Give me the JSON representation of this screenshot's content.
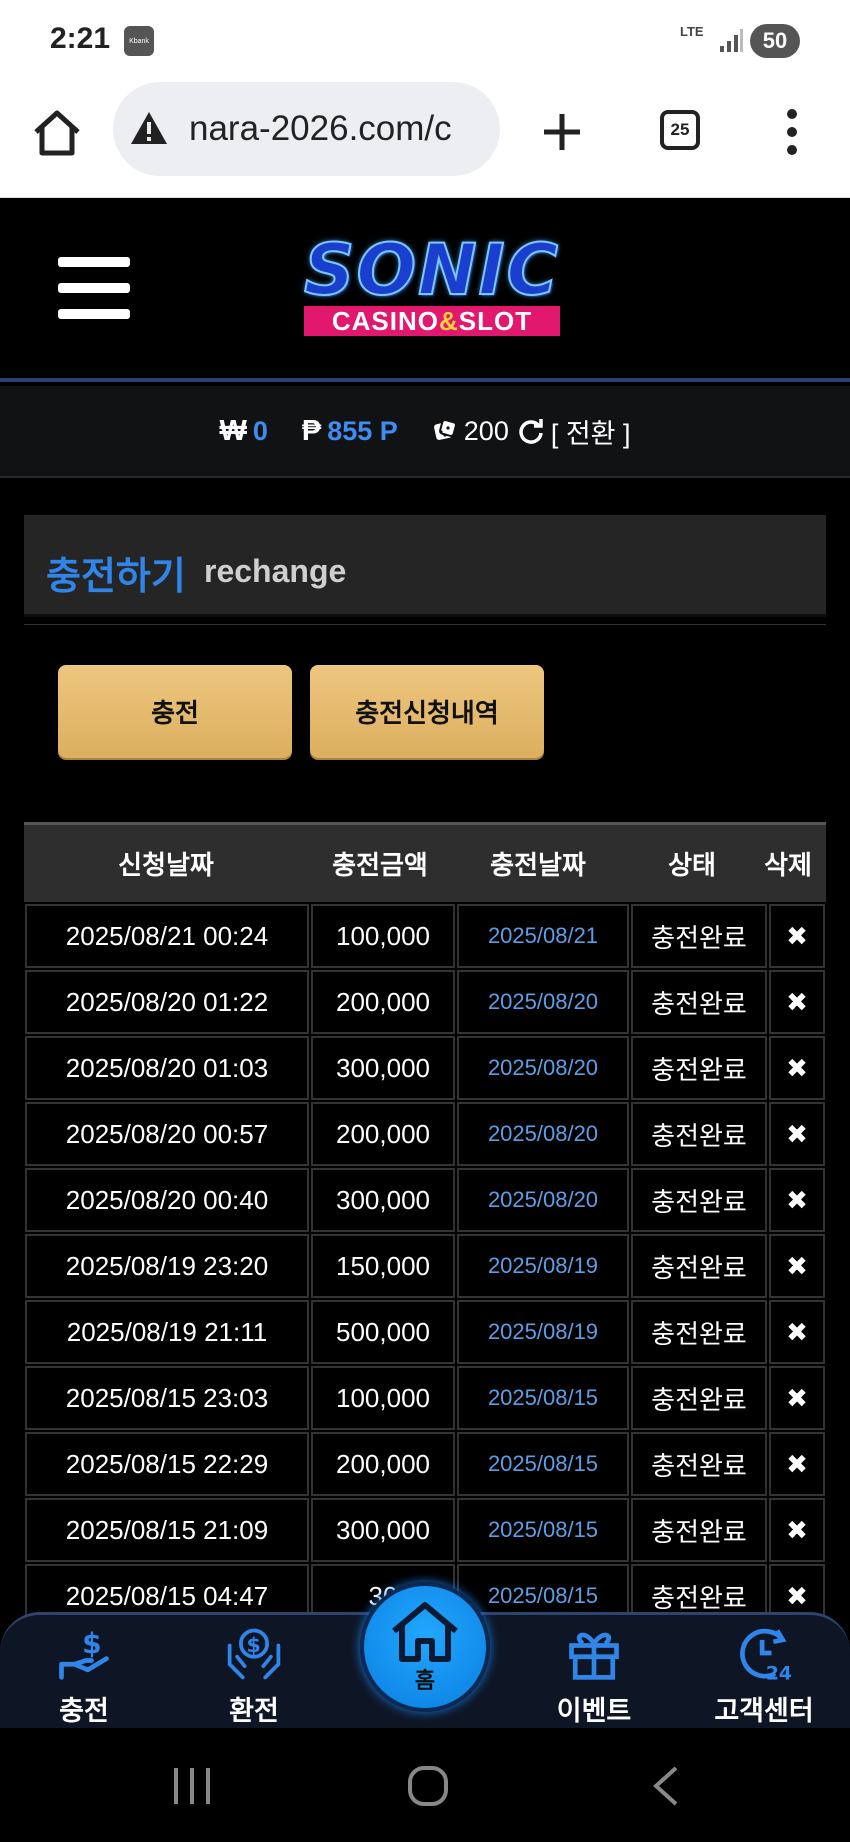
{
  "status_bar": {
    "time": "2:21",
    "app_icon": "Kbank",
    "network": "LTE",
    "battery": "50"
  },
  "browser": {
    "url": "nara-2026.com/c",
    "tab_count": "25"
  },
  "site": {
    "logo_main": "SONIC",
    "logo_sub_left": "CASINO",
    "logo_sub_amp": "&",
    "logo_sub_right": "SLOT"
  },
  "balance": {
    "won_symbol": "₩",
    "won_value": "0",
    "point_symbol": "₱",
    "point_value": "855 P",
    "chip_value": "200",
    "convert_label": "[ 전환 ]"
  },
  "section": {
    "title_ko": "충전하기",
    "title_en": "rechange"
  },
  "buttons": {
    "charge": "충전",
    "history": "충전신청내역"
  },
  "table": {
    "headers": [
      "신청날짜",
      "충전금액",
      "충전날짜",
      "상태",
      "삭제"
    ],
    "rows": [
      {
        "applied": "2025/08/21 00:24",
        "amount": "100,000",
        "charged": "2025/08/21",
        "status": "충전완료",
        "delete": "✖"
      },
      {
        "applied": "2025/08/20 01:22",
        "amount": "200,000",
        "charged": "2025/08/20",
        "status": "충전완료",
        "delete": "✖"
      },
      {
        "applied": "2025/08/20 01:03",
        "amount": "300,000",
        "charged": "2025/08/20",
        "status": "충전완료",
        "delete": "✖"
      },
      {
        "applied": "2025/08/20 00:57",
        "amount": "200,000",
        "charged": "2025/08/20",
        "status": "충전완료",
        "delete": "✖"
      },
      {
        "applied": "2025/08/20 00:40",
        "amount": "300,000",
        "charged": "2025/08/20",
        "status": "충전완료",
        "delete": "✖"
      },
      {
        "applied": "2025/08/19 23:20",
        "amount": "150,000",
        "charged": "2025/08/19",
        "status": "충전완료",
        "delete": "✖"
      },
      {
        "applied": "2025/08/19 21:11",
        "amount": "500,000",
        "charged": "2025/08/19",
        "status": "충전완료",
        "delete": "✖"
      },
      {
        "applied": "2025/08/15 23:03",
        "amount": "100,000",
        "charged": "2025/08/15",
        "status": "충전완료",
        "delete": "✖"
      },
      {
        "applied": "2025/08/15 22:29",
        "amount": "200,000",
        "charged": "2025/08/15",
        "status": "충전완료",
        "delete": "✖"
      },
      {
        "applied": "2025/08/15 21:09",
        "amount": "300,000",
        "charged": "2025/08/15",
        "status": "충전완료",
        "delete": "✖"
      },
      {
        "applied": "2025/08/15 04:47",
        "amount": "30",
        "charged": "2025/08/15",
        "status": "충전완료",
        "delete": "✖"
      }
    ]
  },
  "bottom_nav": {
    "charge": "충전",
    "exchange": "환전",
    "home": "홈",
    "event": "이벤트",
    "support": "고객센터"
  },
  "colors": {
    "accent_blue": "#2f86e8",
    "gold_button": "#e6bd70",
    "nav_home": "#1593f0"
  }
}
